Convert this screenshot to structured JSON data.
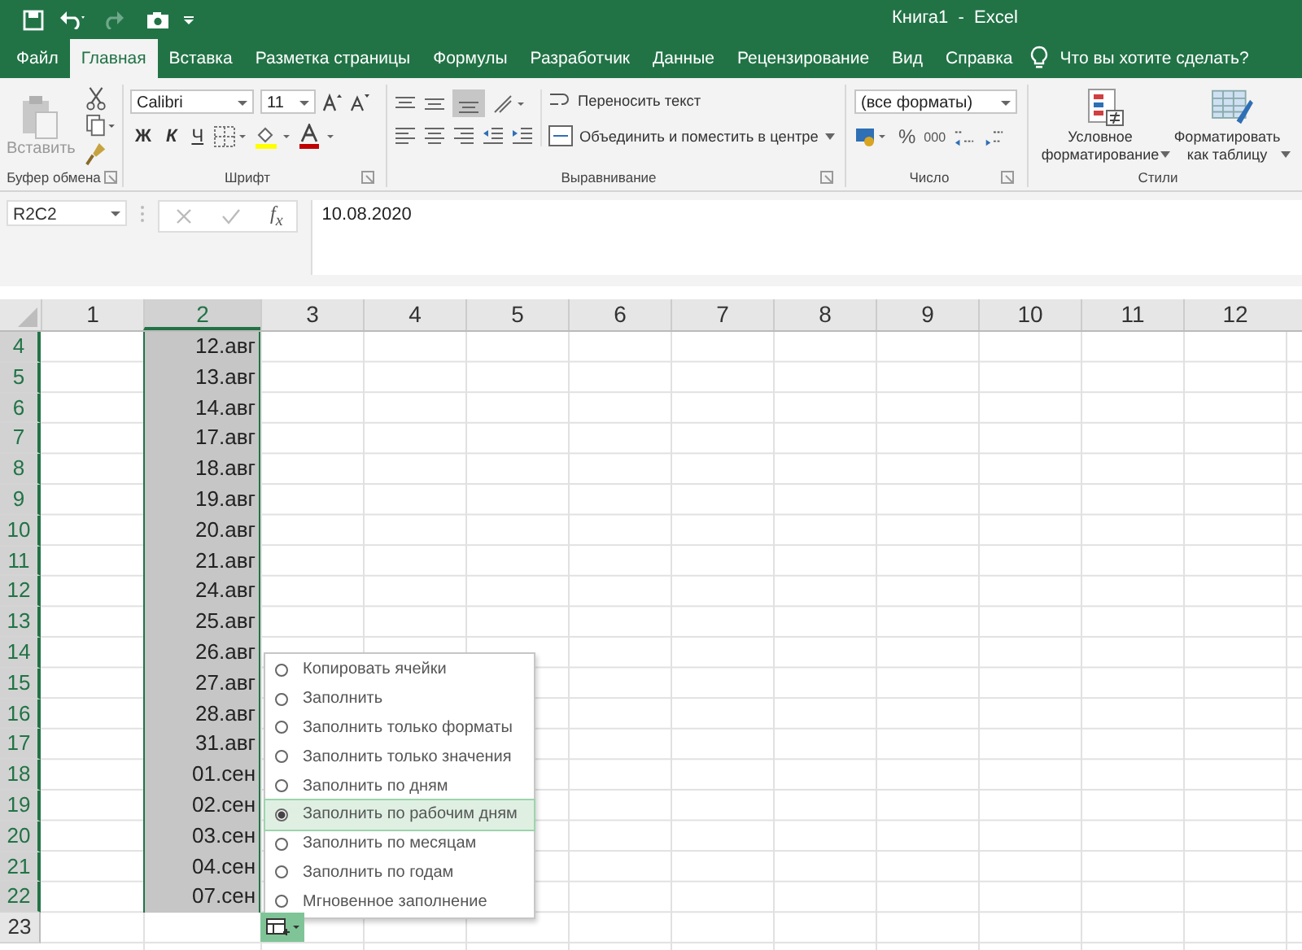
{
  "window": {
    "title": "Книга1  -  Excel"
  },
  "tabs": [
    {
      "label": "Файл",
      "selected": false
    },
    {
      "label": "Главная",
      "selected": true
    },
    {
      "label": "Вставка",
      "selected": false
    },
    {
      "label": "Разметка страницы",
      "selected": false
    },
    {
      "label": "Формулы",
      "selected": false
    },
    {
      "label": "Разработчик",
      "selected": false
    },
    {
      "label": "Данные",
      "selected": false
    },
    {
      "label": "Рецензирование",
      "selected": false
    },
    {
      "label": "Вид",
      "selected": false
    },
    {
      "label": "Справка",
      "selected": false
    }
  ],
  "tell_me": "Что вы хотите сделать?",
  "ribbon": {
    "clipboard": {
      "paste": "Вставить",
      "name": "Буфер обмена"
    },
    "font": {
      "font": "Calibri",
      "size": "11",
      "bold": "Ж",
      "italic": "К",
      "underline": "Ч",
      "name": "Шрифт"
    },
    "alignment": {
      "wrap": "Переносить текст",
      "merge": "Объединить и поместить в центре",
      "name": "Выравнивание"
    },
    "number": {
      "format": "(все форматы)",
      "percent": "%",
      "thousands": "000",
      "name": "Число"
    },
    "styles": {
      "conditional": "Условное форматирование",
      "table": "Форматировать как таблицу",
      "name": "Стили"
    }
  },
  "formula_bar": {
    "name_box": "R2C2",
    "fx": "f$_{x}$",
    "value": "10.08.2020"
  },
  "columns": [
    {
      "label": "1",
      "selected": false
    },
    {
      "label": "2",
      "selected": true
    },
    {
      "label": "3",
      "selected": false
    },
    {
      "label": "4",
      "selected": false
    },
    {
      "label": "5",
      "selected": false
    },
    {
      "label": "6",
      "selected": false
    },
    {
      "label": "7",
      "selected": false
    },
    {
      "label": "8",
      "selected": false
    },
    {
      "label": "9",
      "selected": false
    },
    {
      "label": "10",
      "selected": false
    },
    {
      "label": "11",
      "selected": false
    },
    {
      "label": "12",
      "selected": false
    }
  ],
  "rows": [
    {
      "number": "4",
      "value": "12.авг",
      "selected": true
    },
    {
      "number": "5",
      "value": "13.авг",
      "selected": true
    },
    {
      "number": "6",
      "value": "14.авг",
      "selected": true
    },
    {
      "number": "7",
      "value": "17.авг",
      "selected": true
    },
    {
      "number": "8",
      "value": "18.авг",
      "selected": true
    },
    {
      "number": "9",
      "value": "19.авг",
      "selected": true
    },
    {
      "number": "10",
      "value": "20.авг",
      "selected": true
    },
    {
      "number": "11",
      "value": "21.авг",
      "selected": true
    },
    {
      "number": "12",
      "value": "24.авг",
      "selected": true
    },
    {
      "number": "13",
      "value": "25.авг",
      "selected": true
    },
    {
      "number": "14",
      "value": "26.авг",
      "selected": true
    },
    {
      "number": "15",
      "value": "27.авг",
      "selected": true
    },
    {
      "number": "16",
      "value": "28.авг",
      "selected": true
    },
    {
      "number": "17",
      "value": "31.авг",
      "selected": true
    },
    {
      "number": "18",
      "value": "01.сен",
      "selected": true
    },
    {
      "number": "19",
      "value": "02.сен",
      "selected": true
    },
    {
      "number": "20",
      "value": "03.сен",
      "selected": true
    },
    {
      "number": "21",
      "value": "04.сен",
      "selected": true
    },
    {
      "number": "22",
      "value": "07.сен",
      "selected": true
    },
    {
      "number": "23",
      "selected": false
    }
  ],
  "autofill_menu": [
    {
      "label": "Копировать ячейки",
      "selected": false
    },
    {
      "label": "Заполнить",
      "selected": false
    },
    {
      "label": "Заполнить только форматы",
      "selected": false
    },
    {
      "label": "Заполнить только значения",
      "selected": false
    },
    {
      "label": "Заполнить по дням",
      "selected": false
    },
    {
      "label": "Заполнить по рабочим дням",
      "selected": true
    },
    {
      "label": "Заполнить по месяцам",
      "selected": false
    },
    {
      "label": "Заполнить по годам",
      "selected": false
    },
    {
      "label": "Мгновенное заполнение",
      "selected": false
    }
  ]
}
